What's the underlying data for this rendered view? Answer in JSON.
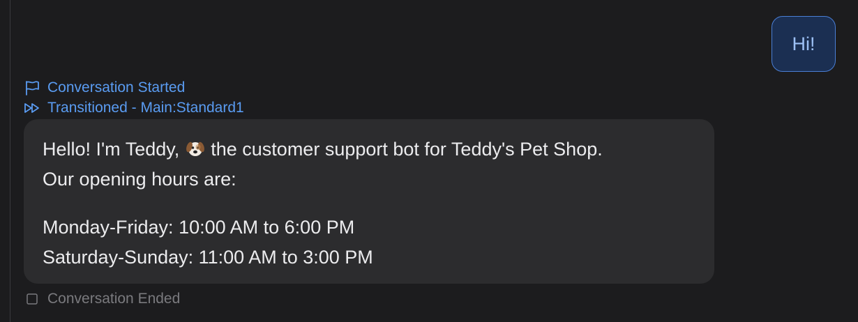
{
  "user_message": {
    "text": "Hi!"
  },
  "events": {
    "started": {
      "label": "Conversation Started",
      "icon": "flag-icon"
    },
    "transitioned": {
      "label": "Transitioned - Main:Standard1",
      "icon": "fast-forward-icon"
    },
    "ended": {
      "label": "Conversation Ended",
      "icon": "square-icon"
    }
  },
  "bot_message": {
    "line1_before_emoji": "Hello! I'm Teddy, ",
    "emoji": "dog-face-icon",
    "line1_after_emoji": " the customer support bot for Teddy's Pet Shop.",
    "line2": "Our opening hours are:",
    "line3": "Monday-Friday: 10:00 AM to 6:00 PM",
    "line4": "Saturday-Sunday: 11:00 AM to 3:00 PM"
  },
  "colors": {
    "background": "#1c1c1e",
    "bot_bubble": "#2c2c2e",
    "user_bubble_fill": "#1b2f52",
    "user_bubble_border": "#4a7fd6",
    "event_accent": "#5a9cf2",
    "ended_text": "#7a7a7e"
  }
}
